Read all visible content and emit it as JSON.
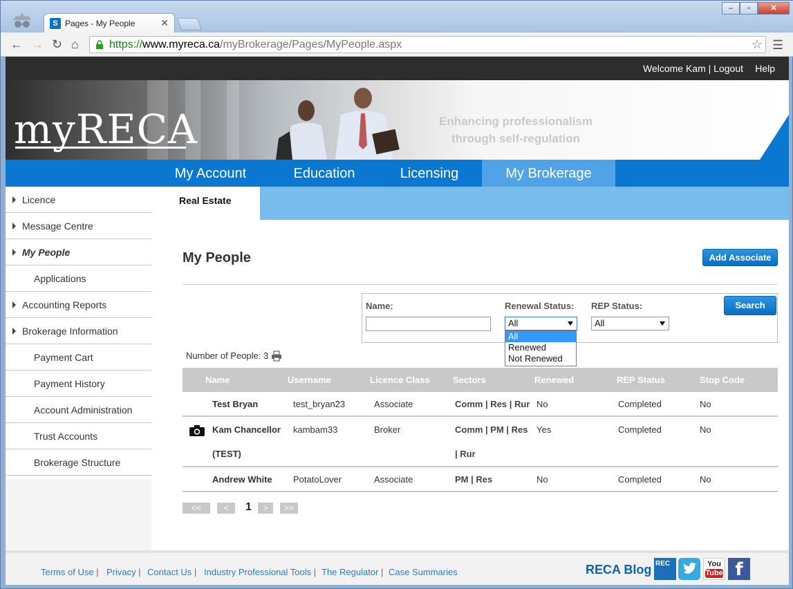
{
  "browser": {
    "tab_title": "Pages - My People",
    "tab_favicon": "S",
    "url_scheme": "https://",
    "url_host": "www.myreca.ca",
    "url_path": "/myBrokerage/Pages/MyPeople.aspx",
    "window_buttons": [
      "–",
      "▫",
      "✕"
    ]
  },
  "topbar": {
    "welcome": "Welcome Kam | Logout",
    "help": "Help"
  },
  "banner": {
    "logo": "myRECA",
    "tagline_line1": "Enhancing professionalism",
    "tagline_line2": "through self-regulation"
  },
  "mainnav": [
    "My Account",
    "Education",
    "Licensing",
    "My Brokerage"
  ],
  "subnav": {
    "active": "Real Estate"
  },
  "sidebar": {
    "items": [
      {
        "label": "Licence"
      },
      {
        "label": "Message Centre"
      },
      {
        "label": "My People"
      },
      {
        "label": "Applications"
      },
      {
        "label": "Accounting Reports"
      },
      {
        "label": "Brokerage Information"
      },
      {
        "label": "Payment Cart"
      },
      {
        "label": "Payment History"
      },
      {
        "label": "Account Administration"
      },
      {
        "label": "Trust Accounts"
      },
      {
        "label": "Brokerage Structure"
      }
    ]
  },
  "main": {
    "title": "My People",
    "add_button": "Add Associate",
    "filter": {
      "name_label": "Name:",
      "name_value": "",
      "renewal_label": "Renewal Status:",
      "renewal_value": "All",
      "renewal_options": [
        "All",
        "Renewed",
        "Not Renewed"
      ],
      "rep_label": "REP Status:",
      "rep_value": "All",
      "search_button": "Search"
    },
    "count_text": "Number of People: 3",
    "table": {
      "headers": [
        "Name",
        "Username",
        "Licence Class",
        "Sectors",
        "Renewed",
        "REP Status",
        "Stop Code"
      ],
      "rows": [
        {
          "name": "Test Bryan",
          "name2": "",
          "username": "test_bryan23",
          "class": "Associate",
          "sectors": "Comm | Res | Rur",
          "sectors2": "",
          "renewed": "No",
          "rep": "Completed",
          "stop": "No"
        },
        {
          "name": "Kam Chancellor",
          "name2": "(TEST)",
          "username": "kambam33",
          "class": "Broker",
          "sectors": "Comm | PM | Res",
          "sectors2": "| Rur",
          "renewed": "Yes",
          "rep": "Completed",
          "stop": "No"
        },
        {
          "name": "Andrew White",
          "name2": "",
          "username": "PotatoLover",
          "class": "Associate",
          "sectors": "PM | Res",
          "sectors2": "",
          "renewed": "No",
          "rep": "Completed",
          "stop": "No"
        }
      ]
    },
    "pager": {
      "first": "<<",
      "prev": "<",
      "current": "1",
      "next": ">",
      "last": ">>"
    }
  },
  "footer": {
    "links": [
      "Terms of Use",
      "Privacy",
      "Contact Us",
      "Industry Professional Tools",
      "The Regulator",
      "Case Summaries"
    ],
    "blog": "RECA Blog",
    "social": [
      {
        "icon": "reca-icon",
        "text": "REC"
      },
      {
        "icon": "twitter-icon",
        "text": ""
      },
      {
        "icon": "youtube-icon",
        "text": "You Tube"
      },
      {
        "icon": "facebook-icon",
        "text": "f"
      }
    ]
  },
  "colors": {
    "accent": "#0a78d1",
    "nav_active": "#4fa3e6",
    "sub_bar": "#78bceb",
    "table_head": "#c9c9c9"
  }
}
